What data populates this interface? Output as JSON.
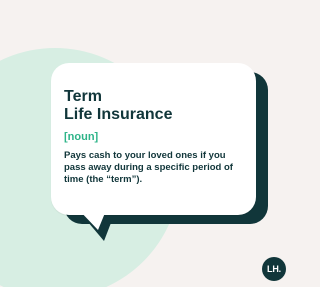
{
  "card": {
    "title_line1": "Term",
    "title_line2": "Life Insurance",
    "part_of_speech": "[noun]",
    "definition": "Pays cash to your loved ones if you pass away during a specific period of time (the “term”)."
  },
  "brand": {
    "logo_text": "LH."
  },
  "colors": {
    "background": "#f6f2f0",
    "mint_circle": "#d7eee3",
    "dark_navy": "#11363a",
    "accent_green": "#2eb489",
    "bubble_white": "#ffffff"
  }
}
